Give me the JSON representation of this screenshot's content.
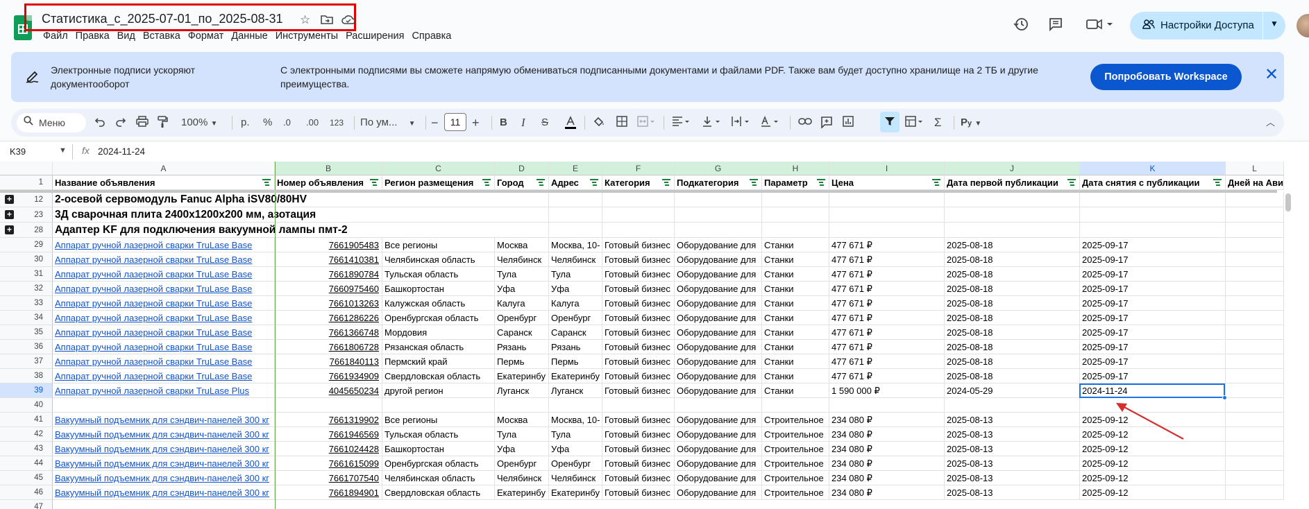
{
  "title": "Статистика_с_2025-07-01_по_2025-08-31",
  "menu": [
    "Файл",
    "Правка",
    "Вид",
    "Вставка",
    "Формат",
    "Данные",
    "Инструменты",
    "Расширения",
    "Справка"
  ],
  "share_label": "Настройки Доступа",
  "banner": {
    "heading": "Электронные подписи ускоряют документооборот",
    "body": "С электронными подписями вы сможете напрямую обмениваться подписанными документами и файлами PDF. Также вам будет доступно хранилище на 2 ТБ и другие преимущества.",
    "button": "Попробовать Workspace"
  },
  "toolbar": {
    "menu_search": "Меню",
    "zoom": "100%",
    "currency": "р.",
    "percent": "%",
    "dec_less": ".0",
    "dec_more": ".00",
    "format_123": "123",
    "font": "По ум...",
    "font_size": "11"
  },
  "formula": {
    "cell": "K39",
    "value": "2024-11-24"
  },
  "columns": [
    "A",
    "B",
    "C",
    "D",
    "E",
    "F",
    "G",
    "H",
    "I",
    "J",
    "K",
    "L"
  ],
  "headers": [
    "Название объявления",
    "Номер объявления",
    "Регион размещения",
    "Город",
    "Адрес",
    "Категория",
    "Подкатегория",
    "Параметр",
    "Цена",
    "Дата первой публикации",
    "Дата снятия с публикации",
    "Дней на Авито"
  ],
  "groups": [
    {
      "row": "12",
      "text": "2-осевой сервомодуль Fanuc Alpha iSV80/80HV"
    },
    {
      "row": "23",
      "text": "3Д сварочная плита 2400x1200x200 мм, азотация"
    },
    {
      "row": "28",
      "text": "Адаптер KF для подключения вакуумной лампы пмт-2"
    }
  ],
  "rows": [
    {
      "n": "29",
      "a": "Аппарат ручной лазерной сварки TruLase Base",
      "b": "7661905483",
      "c": "Все регионы",
      "d": "Москва",
      "e": "Москва, 10-",
      "f": "Готовый бизнес",
      "g": "Оборудование для",
      "h": "Станки",
      "i": "477 671 ₽",
      "j": "2025-08-18",
      "k": "2025-09-17"
    },
    {
      "n": "30",
      "a": "Аппарат ручной лазерной сварки TruLase Base",
      "b": "7661410381",
      "c": "Челябинская область",
      "d": "Челябинск",
      "e": "Челябинск",
      "f": "Готовый бизнес",
      "g": "Оборудование для",
      "h": "Станки",
      "i": "477 671 ₽",
      "j": "2025-08-18",
      "k": "2025-09-17"
    },
    {
      "n": "31",
      "a": "Аппарат ручной лазерной сварки TruLase Base",
      "b": "7661890784",
      "c": "Тульская область",
      "d": "Тула",
      "e": "Тула",
      "f": "Готовый бизнес",
      "g": "Оборудование для",
      "h": "Станки",
      "i": "477 671 ₽",
      "j": "2025-08-18",
      "k": "2025-09-17"
    },
    {
      "n": "32",
      "a": "Аппарат ручной лазерной сварки TruLase Base",
      "b": "7660975460",
      "c": "Башкортостан",
      "d": "Уфа",
      "e": "Уфа",
      "f": "Готовый бизнес",
      "g": "Оборудование для",
      "h": "Станки",
      "i": "477 671 ₽",
      "j": "2025-08-18",
      "k": "2025-09-17"
    },
    {
      "n": "33",
      "a": "Аппарат ручной лазерной сварки TruLase Base",
      "b": "7661013263",
      "c": "Калужская область",
      "d": "Калуга",
      "e": "Калуга",
      "f": "Готовый бизнес",
      "g": "Оборудование для",
      "h": "Станки",
      "i": "477 671 ₽",
      "j": "2025-08-18",
      "k": "2025-09-17"
    },
    {
      "n": "34",
      "a": "Аппарат ручной лазерной сварки TruLase Base",
      "b": "7661286226",
      "c": "Оренбургская область",
      "d": "Оренбург",
      "e": "Оренбург",
      "f": "Готовый бизнес",
      "g": "Оборудование для",
      "h": "Станки",
      "i": "477 671 ₽",
      "j": "2025-08-18",
      "k": "2025-09-17"
    },
    {
      "n": "35",
      "a": "Аппарат ручной лазерной сварки TruLase Base",
      "b": "7661366748",
      "c": "Мордовия",
      "d": "Саранск",
      "e": "Саранск",
      "f": "Готовый бизнес",
      "g": "Оборудование для",
      "h": "Станки",
      "i": "477 671 ₽",
      "j": "2025-08-18",
      "k": "2025-09-17"
    },
    {
      "n": "36",
      "a": "Аппарат ручной лазерной сварки TruLase Base",
      "b": "7661806728",
      "c": "Рязанская область",
      "d": "Рязань",
      "e": "Рязань",
      "f": "Готовый бизнес",
      "g": "Оборудование для",
      "h": "Станки",
      "i": "477 671 ₽",
      "j": "2025-08-18",
      "k": "2025-09-17"
    },
    {
      "n": "37",
      "a": "Аппарат ручной лазерной сварки TruLase Base",
      "b": "7661840113",
      "c": "Пермский край",
      "d": "Пермь",
      "e": "Пермь",
      "f": "Готовый бизнес",
      "g": "Оборудование для",
      "h": "Станки",
      "i": "477 671 ₽",
      "j": "2025-08-18",
      "k": "2025-09-17"
    },
    {
      "n": "38",
      "a": "Аппарат ручной лазерной сварки TruLase Base",
      "b": "7661934909",
      "c": "Свердловская область",
      "d": "Екатеринбу",
      "e": "Екатеринбу",
      "f": "Готовый бизнес",
      "g": "Оборудование для",
      "h": "Станки",
      "i": "477 671 ₽",
      "j": "2025-08-18",
      "k": "2025-09-17"
    },
    {
      "n": "39",
      "a": "Аппарат ручной лазерной сварки TruLase Plus",
      "b": "4045650234",
      "c": "другой регион",
      "d": "Луганск",
      "e": "Луганск",
      "f": "Готовый бизнес",
      "g": "Оборудование для",
      "h": "Станки",
      "i": "1 590 000 ₽",
      "j": "2024-05-29",
      "k": "2024-11-24"
    },
    {
      "n": "40",
      "a": "",
      "b": "",
      "c": "",
      "d": "",
      "e": "",
      "f": "",
      "g": "",
      "h": "",
      "i": "",
      "j": "",
      "k": ""
    },
    {
      "n": "41",
      "a": "Вакуумный подъемник для сэндвич-панелей 300 кг",
      "b": "7661319902",
      "c": "Все регионы",
      "d": "Москва",
      "e": "Москва, 10-",
      "f": "Готовый бизнес",
      "g": "Оборудование для",
      "h": "Строительное",
      "i": "234 080 ₽",
      "j": "2025-08-13",
      "k": "2025-09-12"
    },
    {
      "n": "42",
      "a": "Вакуумный подъемник для сэндвич-панелей 300 кг",
      "b": "7661946569",
      "c": "Тульская область",
      "d": "Тула",
      "e": "Тула",
      "f": "Готовый бизнес",
      "g": "Оборудование для",
      "h": "Строительное",
      "i": "234 080 ₽",
      "j": "2025-08-13",
      "k": "2025-09-12"
    },
    {
      "n": "43",
      "a": "Вакуумный подъемник для сэндвич-панелей 300 кг",
      "b": "7661024428",
      "c": "Башкортостан",
      "d": "Уфа",
      "e": "Уфа",
      "f": "Готовый бизнес",
      "g": "Оборудование для",
      "h": "Строительное",
      "i": "234 080 ₽",
      "j": "2025-08-13",
      "k": "2025-09-12"
    },
    {
      "n": "44",
      "a": "Вакуумный подъемник для сэндвич-панелей 300 кг",
      "b": "7661615099",
      "c": "Оренбургская область",
      "d": "Оренбург",
      "e": "Оренбург",
      "f": "Готовый бизнес",
      "g": "Оборудование для",
      "h": "Строительное",
      "i": "234 080 ₽",
      "j": "2025-08-13",
      "k": "2025-09-12"
    },
    {
      "n": "45",
      "a": "Вакуумный подъемник для сэндвич-панелей 300 кг",
      "b": "7661707540",
      "c": "Челябинская область",
      "d": "Челябинск",
      "e": "Челябинск",
      "f": "Готовый бизнес",
      "g": "Оборудование для",
      "h": "Строительное",
      "i": "234 080 ₽",
      "j": "2025-08-13",
      "k": "2025-09-12"
    },
    {
      "n": "46",
      "a": "Вакуумный подъемник для сэндвич-панелей 300 кг",
      "b": "7661894901",
      "c": "Свердловская область",
      "d": "Екатеринбу",
      "e": "Екатеринбу",
      "f": "Готовый бизнес",
      "g": "Оборудование для",
      "h": "Строительное",
      "i": "234 080 ₽",
      "j": "2025-08-13",
      "k": "2025-09-12"
    }
  ],
  "partial_row": "47"
}
